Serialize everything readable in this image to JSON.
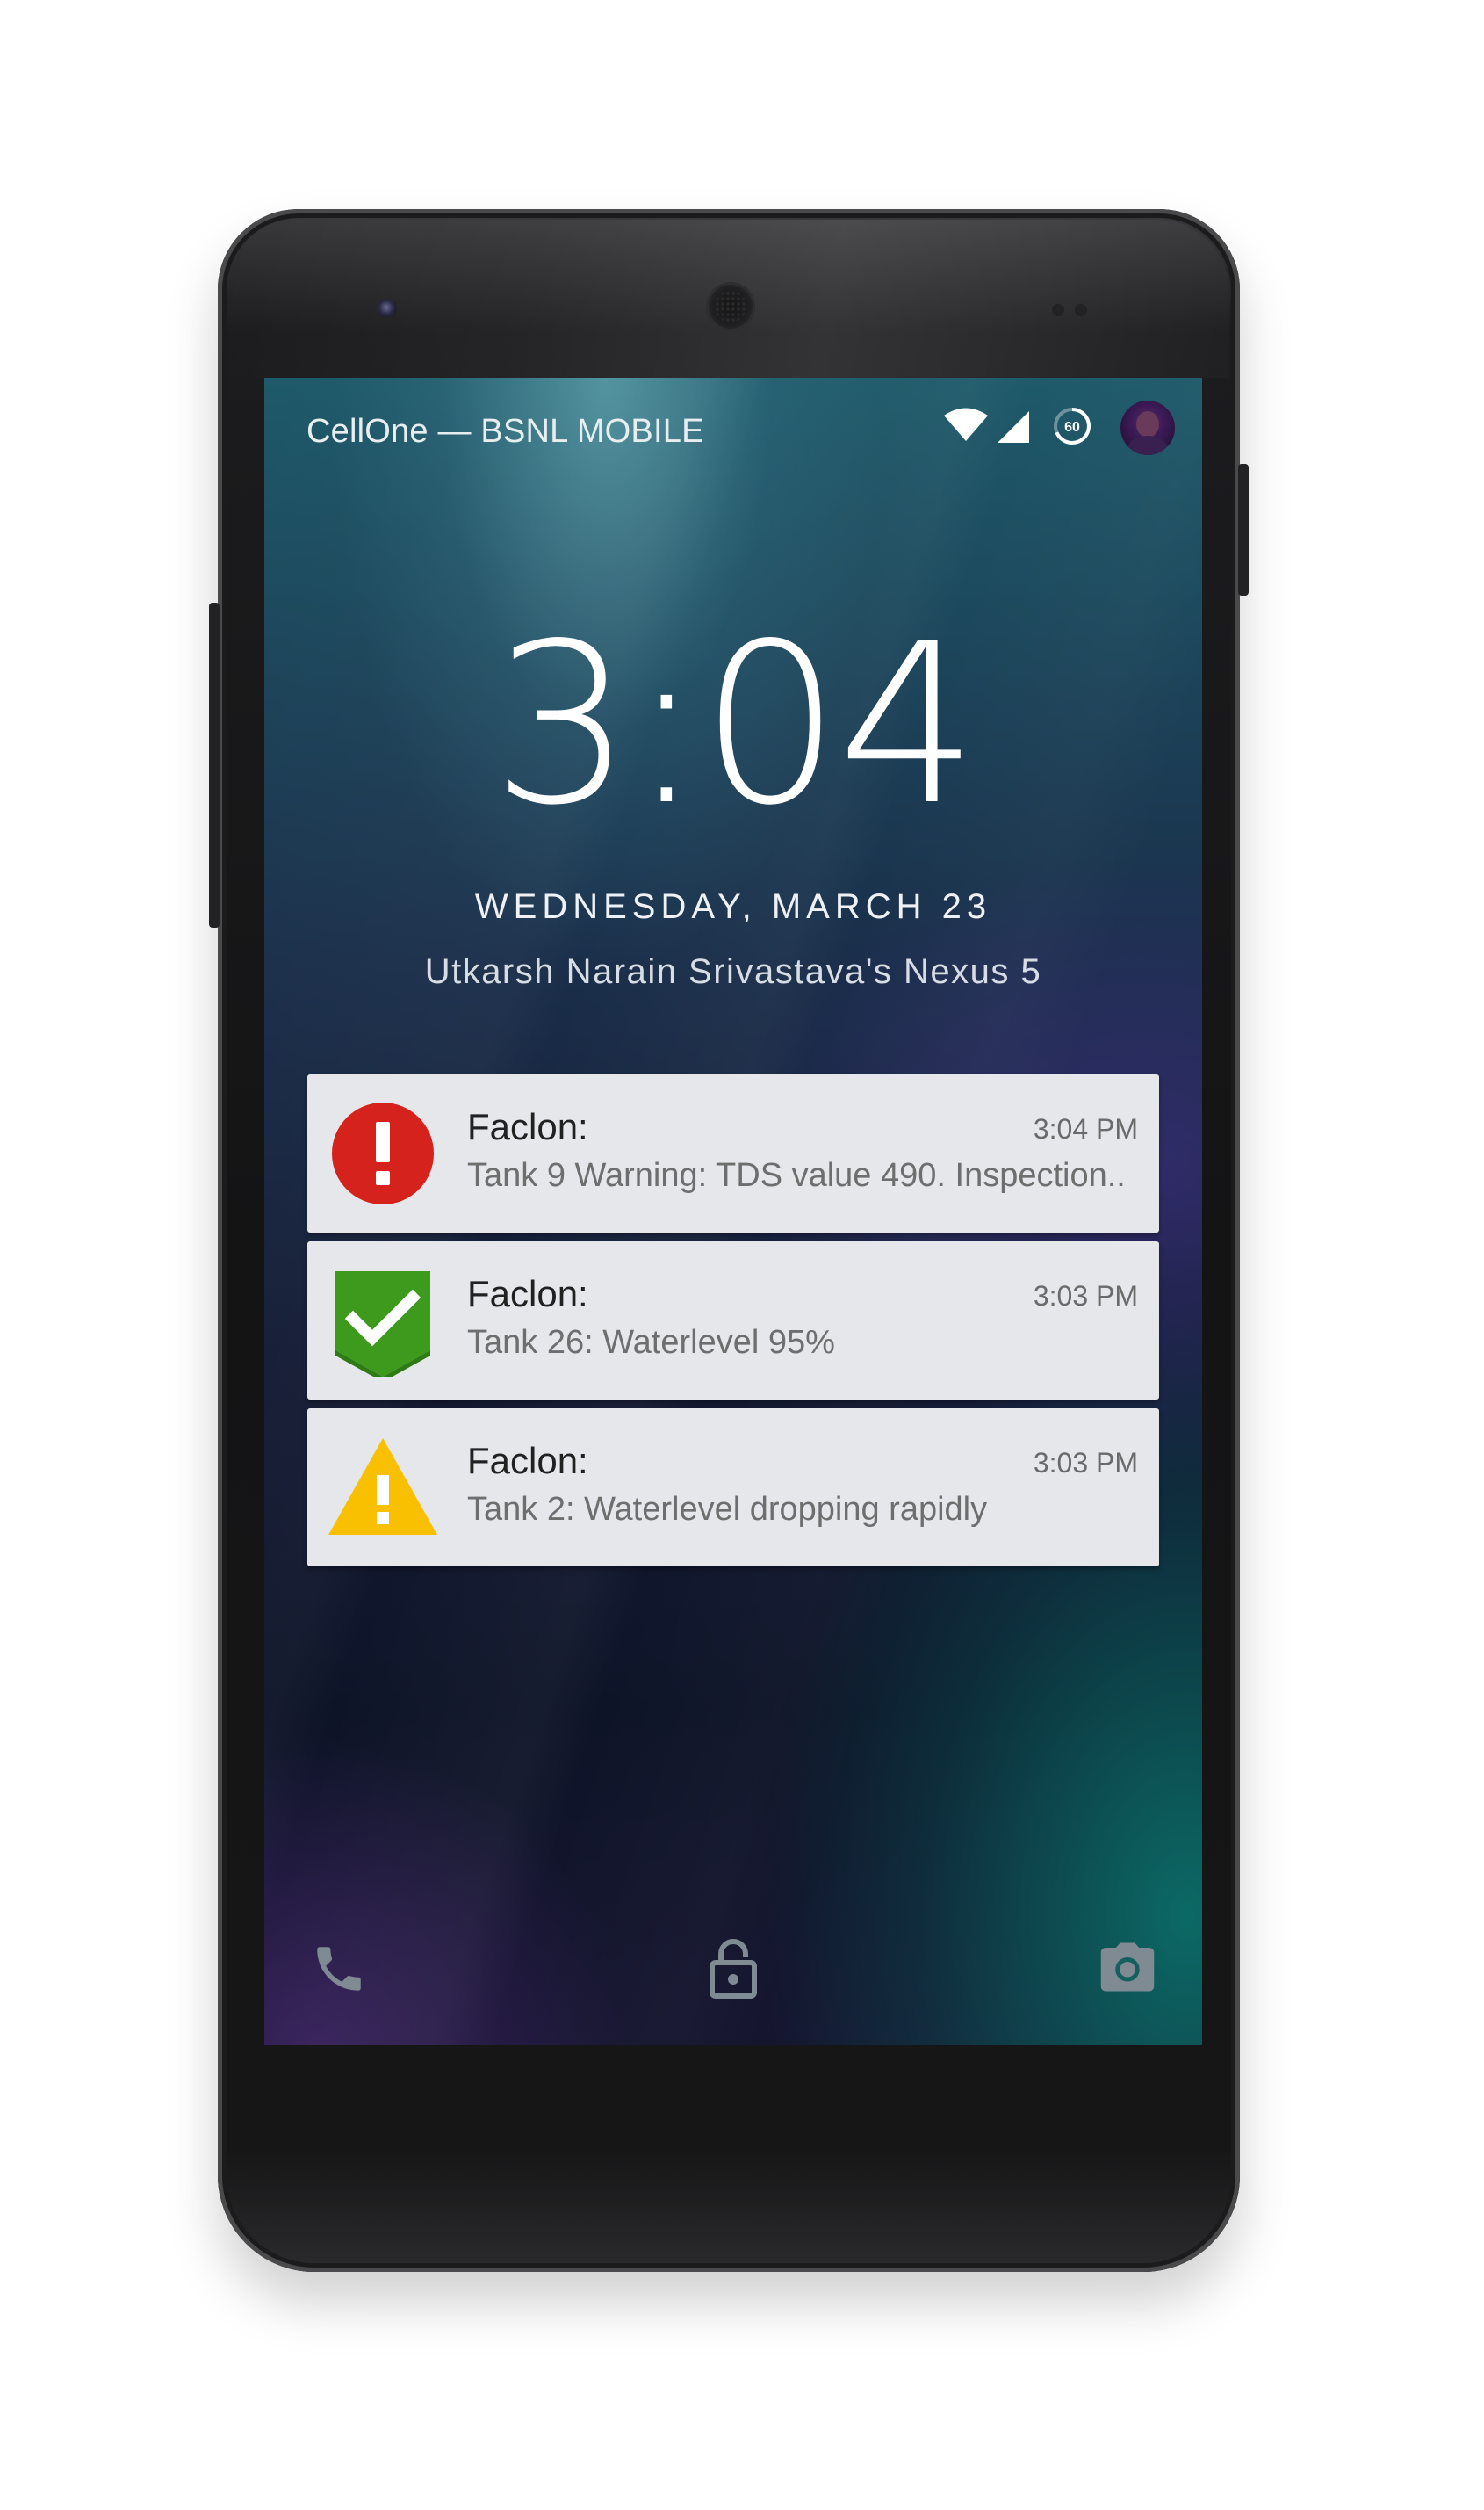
{
  "status_bar": {
    "carrier": "CellOne — BSNL MOBILE",
    "icons": [
      "wifi-icon",
      "cell-signal-icon",
      "battery-charging-icon",
      "user-avatar"
    ],
    "battery_label": "60"
  },
  "lockscreen": {
    "time": "3:04",
    "date": "WEDNESDAY, MARCH 23",
    "owner_info": "Utkarsh Narain Srivastava's Nexus 5"
  },
  "notifications": [
    {
      "icon": "error-circle-icon",
      "icon_color": "#d6221c",
      "title": "Faclon:",
      "time": "3:04 PM",
      "text": "Tank 9 Warning: TDS value 490. Inspection.."
    },
    {
      "icon": "check-shield-icon",
      "icon_color": "#3d9a1d",
      "title": "Faclon:",
      "time": "3:03 PM",
      "text": "Tank 26: Waterlevel 95%"
    },
    {
      "icon": "warning-triangle-icon",
      "icon_color": "#f8c000",
      "title": "Faclon:",
      "time": "3:03 PM",
      "text": "Tank 2: Waterlevel dropping rapidly"
    }
  ],
  "bottom_actions": [
    "phone-icon",
    "lock-icon",
    "camera-icon"
  ]
}
